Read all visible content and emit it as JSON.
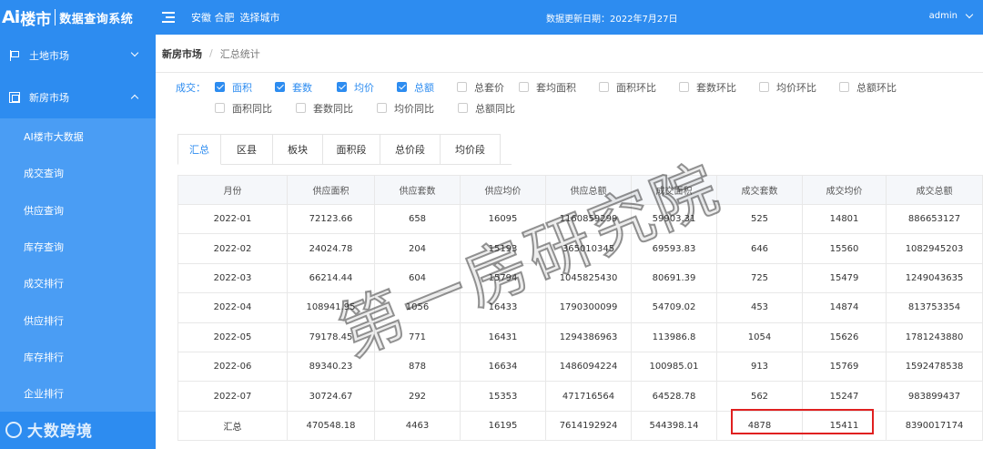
{
  "header": {
    "logo_ai": "Ai",
    "logo_lou": "楼市",
    "system_name": "数据查询系统",
    "city": "安徽 合肥",
    "city_select": "选择城市",
    "update_date": "数据更新日期：2022年7月27日",
    "user": "admin"
  },
  "sidebar": {
    "groups": [
      {
        "label": "土地市场",
        "icon": "flag-icon",
        "expanded": false
      },
      {
        "label": "新房市场",
        "icon": "building-icon",
        "expanded": true
      }
    ],
    "items": [
      {
        "label": "AI楼市大数据"
      },
      {
        "label": "成交查询"
      },
      {
        "label": "供应查询"
      },
      {
        "label": "库存查询"
      },
      {
        "label": "成交排行"
      },
      {
        "label": "供应排行"
      },
      {
        "label": "库存排行"
      },
      {
        "label": "企业排行"
      }
    ],
    "watermark": "大数跨境"
  },
  "breadcrumb": {
    "parent": "新房市场",
    "current": "汇总统计"
  },
  "filters": {
    "label": "成交：",
    "row1": [
      {
        "label": "面积",
        "checked": true
      },
      {
        "label": "套数",
        "checked": true
      },
      {
        "label": "均价",
        "checked": true
      },
      {
        "label": "总额",
        "checked": true
      },
      {
        "label": "总套价",
        "checked": false
      },
      {
        "label": "套均面积",
        "checked": false
      },
      {
        "label": "面积环比",
        "checked": false
      },
      {
        "label": "套数环比",
        "checked": false
      },
      {
        "label": "均价环比",
        "checked": false
      },
      {
        "label": "总额环比",
        "checked": false
      }
    ],
    "row2": [
      {
        "label": "面积同比",
        "checked": false
      },
      {
        "label": "套数同比",
        "checked": false
      },
      {
        "label": "均价同比",
        "checked": false
      },
      {
        "label": "总额同比",
        "checked": false
      }
    ]
  },
  "tabs": [
    "汇总",
    "区县",
    "板块",
    "面积段",
    "总价段",
    "均价段"
  ],
  "table": {
    "headers": [
      "月份",
      "供应面积",
      "供应套数",
      "供应均价",
      "供应总额",
      "成交面积",
      "成交套数",
      "成交均价",
      "成交总额"
    ],
    "rows": [
      [
        "2022-01",
        "72123.66",
        "658",
        "16095",
        "1160859299",
        "59903.31",
        "525",
        "14801",
        "886653127"
      ],
      [
        "2022-02",
        "24024.78",
        "204",
        "15193",
        "365010345",
        "69593.83",
        "646",
        "15560",
        "1082945203"
      ],
      [
        "2022-03",
        "66214.44",
        "604",
        "15794",
        "1045825430",
        "80691.39",
        "725",
        "15479",
        "1249043635"
      ],
      [
        "2022-04",
        "108941.95",
        "1056",
        "16433",
        "1790300099",
        "54709.02",
        "453",
        "14874",
        "813753354"
      ],
      [
        "2022-05",
        "79178.45",
        "771",
        "16431",
        "1294386963",
        "113986.8",
        "1054",
        "15626",
        "1781243880"
      ],
      [
        "2022-06",
        "89340.23",
        "878",
        "16634",
        "1486094224",
        "100985.01",
        "913",
        "15769",
        "1592478538"
      ],
      [
        "2022-07",
        "30724.67",
        "292",
        "15353",
        "471716564",
        "64528.78",
        "562",
        "15247",
        "983899437"
      ],
      [
        "汇总",
        "470548.18",
        "4463",
        "16195",
        "7614192924",
        "544398.14",
        "4878",
        "15411",
        "8390017174"
      ]
    ]
  },
  "watermark_text": "第一房研究院",
  "colors": {
    "primary": "#2d8cf0",
    "highlight": "#e02020"
  }
}
